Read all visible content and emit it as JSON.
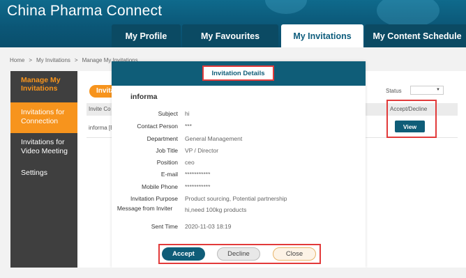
{
  "header": {
    "brand": "China Pharma Connect",
    "tabs": [
      {
        "label": "My Profile"
      },
      {
        "label": "My Favourites"
      },
      {
        "label": "My Invitations"
      },
      {
        "label": "My Content Schedule"
      }
    ]
  },
  "breadcrumb": [
    "Home",
    ">",
    "My Invitations",
    ">",
    "Manage My Invitations"
  ],
  "sidebar": {
    "title": "Manage My Invitations",
    "items": [
      {
        "label": "Invitations for Connection"
      },
      {
        "label": "Invitations for Video Meeting"
      },
      {
        "label": "Settings"
      }
    ]
  },
  "background": {
    "pill": "Invita",
    "status_label": "Status",
    "table_col": "Invite Co",
    "table_cell": "informa [B",
    "accept_decline_header": "Accept/Decline",
    "view_button": "View"
  },
  "modal": {
    "title": "Invitation Details",
    "company": "informa",
    "fields": [
      {
        "label": "Subject",
        "value": "hi"
      },
      {
        "label": "Contact Person",
        "value": "***"
      },
      {
        "label": "Department",
        "value": "General Management"
      },
      {
        "label": "Job Title",
        "value": "VP / Director"
      },
      {
        "label": "Position",
        "value": "ceo"
      },
      {
        "label": "E-mail",
        "value": "***********"
      },
      {
        "label": "Mobile Phone",
        "value": "***********"
      },
      {
        "label": "Invitation Purpose",
        "value": "Product sourcing, Potential partnership"
      },
      {
        "label": "Message from Inviter",
        "value": "hi,need 100kg products"
      },
      {
        "label": "Sent Time",
        "value": "2020-11-03 18:19"
      }
    ],
    "buttons": {
      "accept": "Accept",
      "decline": "Decline",
      "close": "Close"
    }
  },
  "colors": {
    "header_teal": "#0f5d78",
    "accent_orange": "#f7941d",
    "sidebar_dark": "#3f3f3f",
    "highlight_red": "#e23a3a"
  }
}
